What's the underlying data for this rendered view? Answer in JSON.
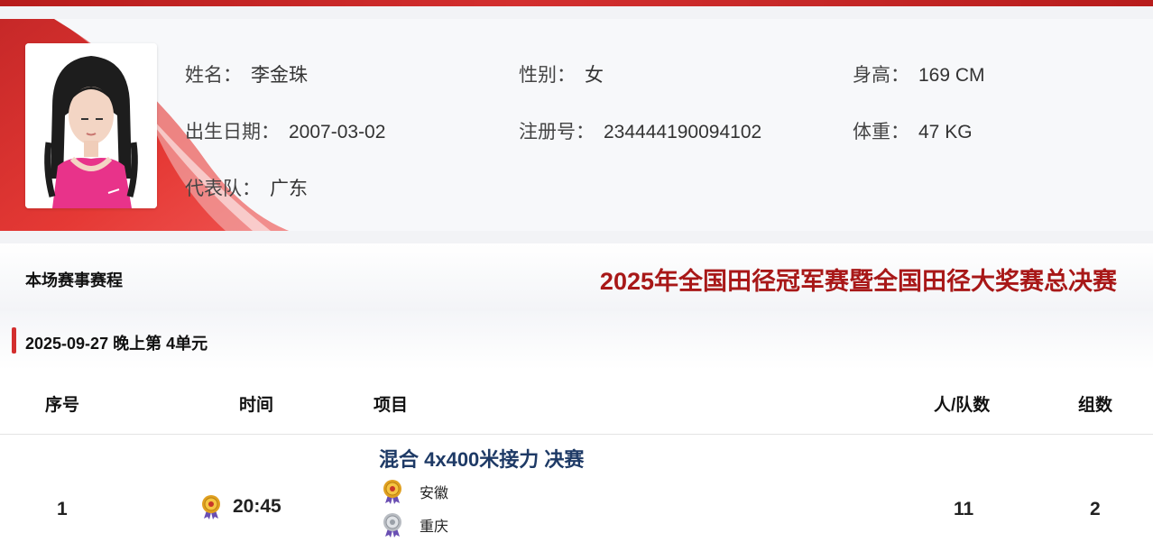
{
  "athlete": {
    "name_label": "姓名：",
    "name": "李金珠",
    "gender_label": "性别：",
    "gender": "女",
    "height_label": "身高：",
    "height": "169 CM",
    "birth_label": "出生日期：",
    "birth": "2007-03-02",
    "reg_label": "注册号：",
    "reg_no": "234444190094102",
    "weight_label": "体重：",
    "weight": "47 KG",
    "team_label": "代表队：",
    "team": "广东"
  },
  "schedule": {
    "title": "本场赛事赛程",
    "event_name": "2025年全国田径冠军赛暨全国田径大奖赛总决赛",
    "session": "2025-09-27 晚上第 4单元",
    "columns": [
      "序号",
      "时间",
      "项目",
      "人/队数",
      "组数"
    ],
    "rows": [
      {
        "no": "1",
        "time": "20:45",
        "item": "混合 4x400米接力 决赛",
        "medalists": [
          {
            "rank": "gold",
            "team": "安徽"
          },
          {
            "rank": "silver",
            "team": "重庆"
          }
        ],
        "count": "11",
        "groups": "2"
      }
    ]
  },
  "colors": {
    "accent_red": "#d32f2f",
    "event_title": "#a81818",
    "item_title": "#1e3a66",
    "gold": "#e0a020",
    "silver": "#b8bcc2"
  }
}
